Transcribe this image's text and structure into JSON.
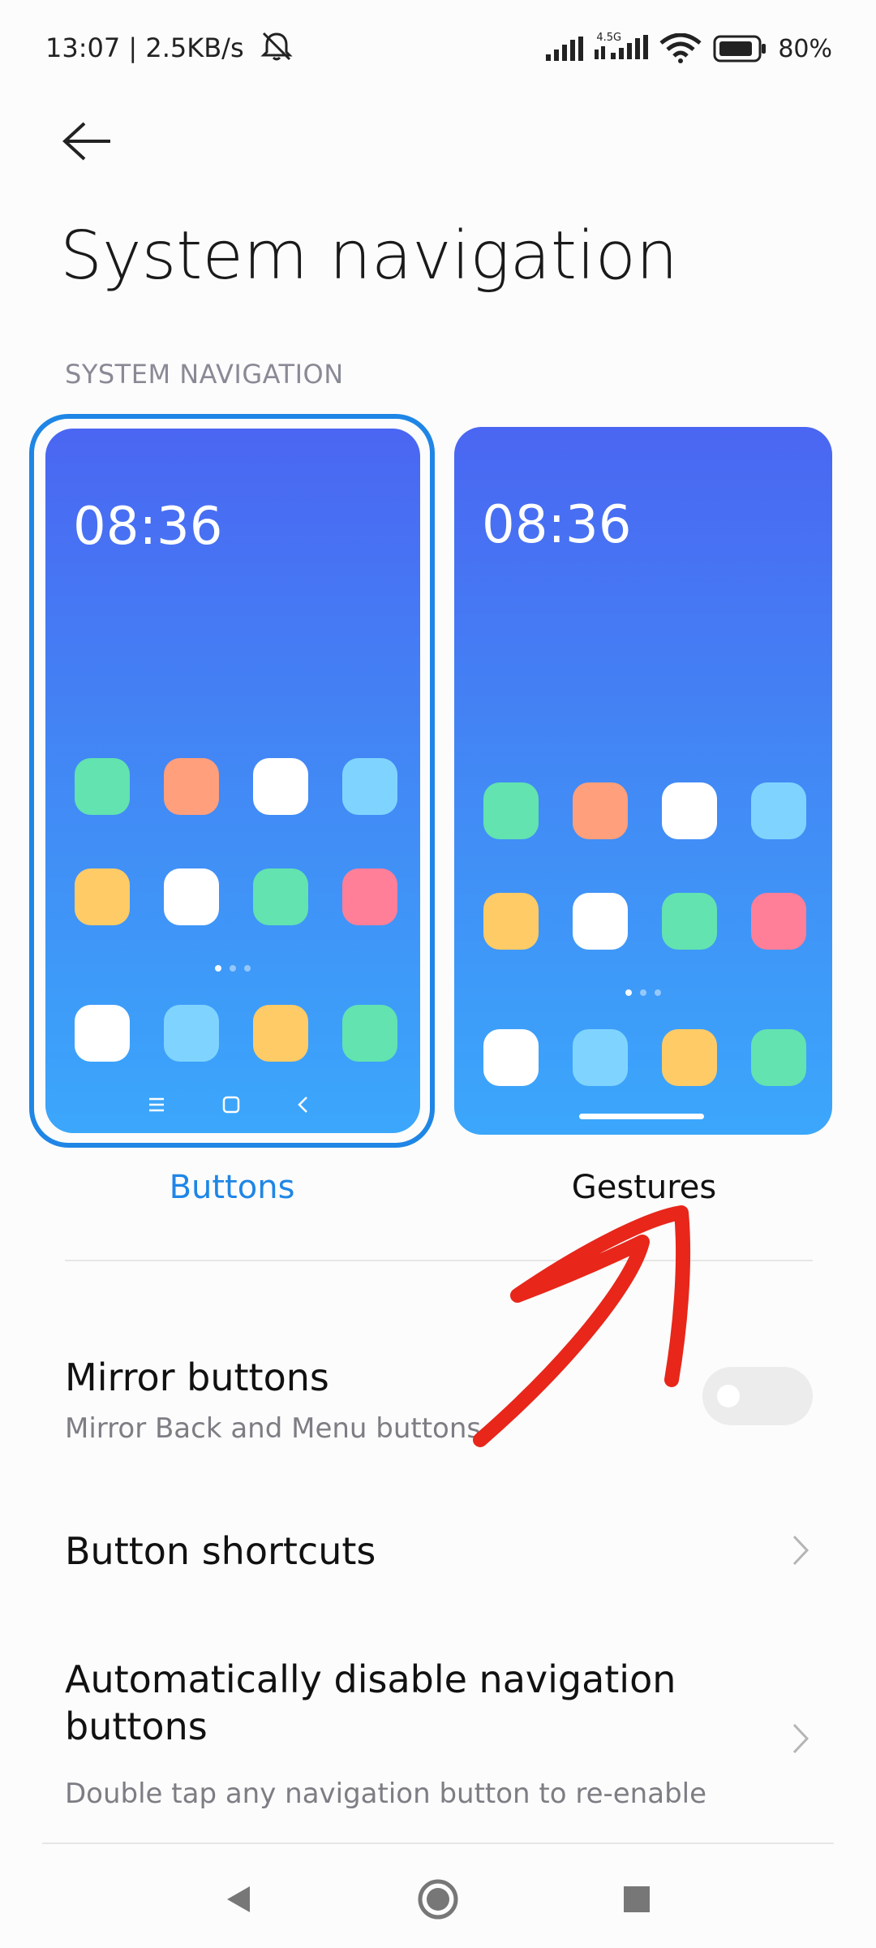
{
  "status_bar": {
    "time_speed": "13:07 | 2.5KB/s",
    "network_type": "4.5G",
    "battery_percent": "80%",
    "icons": [
      "mute-icon",
      "signal-icon",
      "signal-4-5g-icon",
      "wifi-icon",
      "battery-icon"
    ]
  },
  "header": {
    "title": "System navigation",
    "section_label": "SYSTEM NAVIGATION"
  },
  "nav_options": {
    "selected": "buttons",
    "buttons": {
      "label": "Buttons",
      "clock": "08:36"
    },
    "gestures": {
      "label": "Gestures",
      "clock": "08:36"
    },
    "app_colors": [
      "#62e3b0",
      "#ff9f7c",
      "#ffffff",
      "#7fd4ff",
      "#ffcb66",
      "#ffffff",
      "#62e3b0",
      "#ff7f98"
    ],
    "dock_colors": [
      "#ffffff",
      "#7fd4ff",
      "#ffcb66",
      "#62e3b0"
    ],
    "accent": "#1f86e6"
  },
  "settings": {
    "mirror": {
      "title": "Mirror buttons",
      "subtitle": "Mirror Back and Menu buttons",
      "enabled": false
    },
    "shortcuts": {
      "title": "Button shortcuts"
    },
    "auto_disable": {
      "title": "Automatically disable navigation buttons",
      "subtitle": "Double tap any navigation button to re-enable"
    }
  },
  "annotation": {
    "color": "#e8261a",
    "icon": "red-arrow-pointing-to-gestures"
  },
  "system_nav": {
    "icons": [
      "back-triangle-icon",
      "home-circle-icon",
      "recents-square-icon"
    ]
  }
}
